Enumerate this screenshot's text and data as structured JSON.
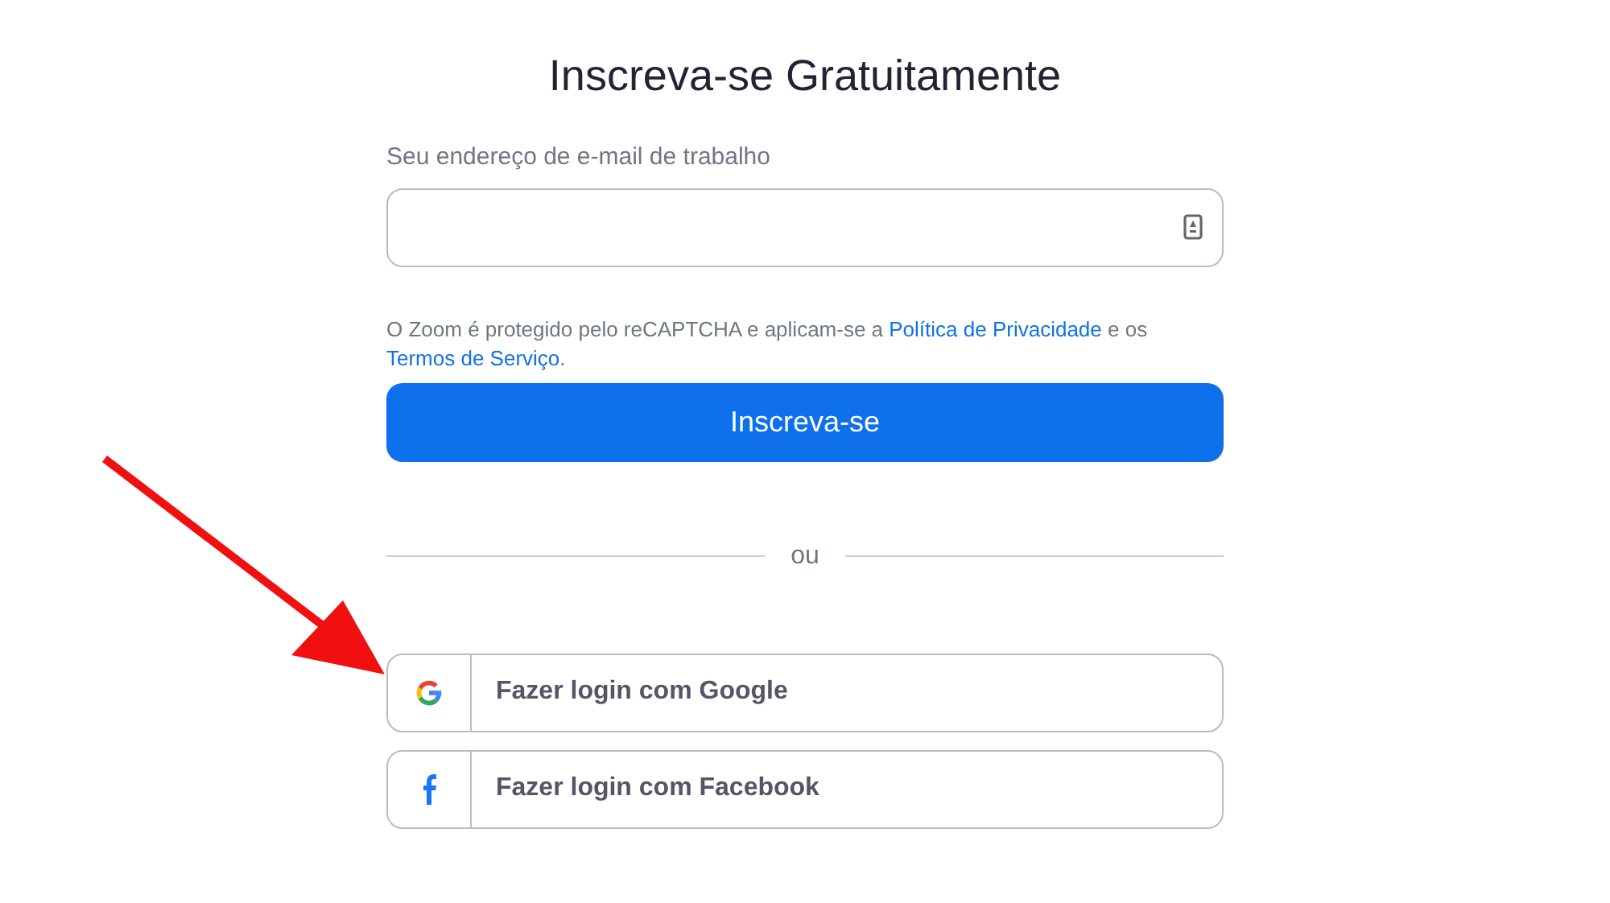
{
  "title": "Inscreva-se Gratuitamente",
  "email": {
    "label": "Seu endereço de e-mail de trabalho"
  },
  "legal": [
    {
      "kind": "text",
      "text": "O Zoom é protegido pelo reCAPTCHA e aplicam-se a "
    },
    {
      "kind": "link",
      "text": "Política de Privacidade"
    },
    {
      "kind": "text",
      "text": " e os "
    },
    {
      "kind": "link",
      "text": "Termos de Serviço"
    },
    {
      "kind": "text",
      "text": "."
    }
  ],
  "submit": "Inscreva-se",
  "divider": "ou",
  "social": [
    {
      "kind": "google",
      "label": "Fazer login com Google"
    },
    {
      "kind": "facebook",
      "label": "Fazer login com Facebook"
    }
  ]
}
